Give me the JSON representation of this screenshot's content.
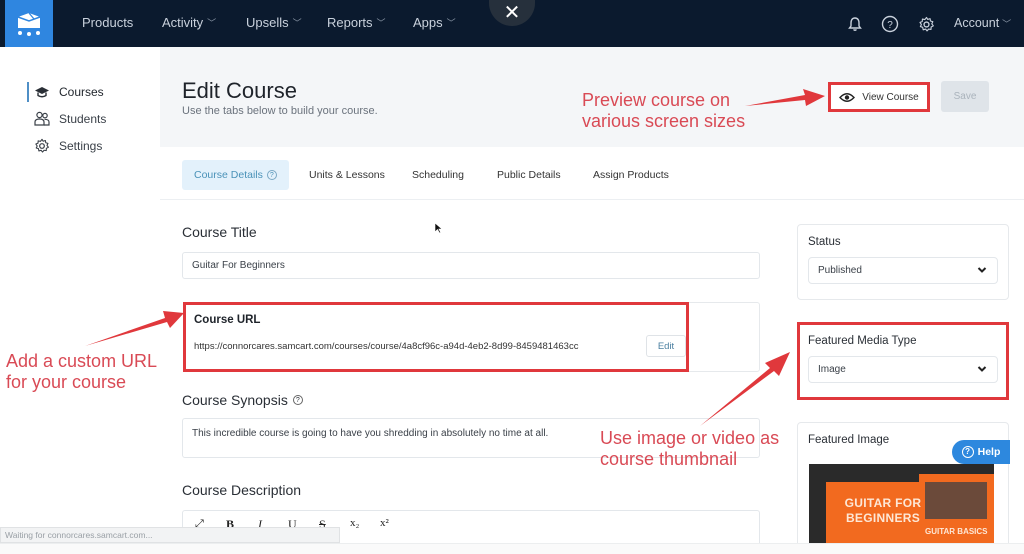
{
  "topnav": {
    "logo_icon": "shopping-cart-box-icon",
    "items": [
      {
        "label": "Products",
        "has_dropdown": false
      },
      {
        "label": "Activity",
        "has_dropdown": true
      },
      {
        "label": "Upsells",
        "has_dropdown": true
      },
      {
        "label": "Reports",
        "has_dropdown": true
      },
      {
        "label": "Apps",
        "has_dropdown": true
      }
    ],
    "close_symbol": "✕",
    "icons": [
      "bell-icon",
      "help-circle-icon",
      "gear-icon"
    ],
    "account_label": "Account",
    "chevron": "⌄"
  },
  "sidebar": {
    "items": [
      {
        "label": "Courses",
        "icon": "graduation-cap-icon",
        "active": true
      },
      {
        "label": "Students",
        "icon": "users-icon",
        "active": false
      },
      {
        "label": "Settings",
        "icon": "gear-icon",
        "active": false
      }
    ]
  },
  "header": {
    "title": "Edit Course",
    "subtitle": "Use the tabs below to build your course.",
    "view_course_label": "View Course",
    "save_label": "Save"
  },
  "tabs": [
    {
      "label": "Course Details",
      "active": true,
      "help": "?"
    },
    {
      "label": "Units & Lessons",
      "active": false
    },
    {
      "label": "Scheduling",
      "active": false
    },
    {
      "label": "Public Details",
      "active": false
    },
    {
      "label": "Assign Products",
      "active": false
    }
  ],
  "form": {
    "course_title_label": "Course Title",
    "course_title_value": "Guitar For Beginners",
    "course_url_label": "Course URL",
    "course_url_value": "https://connorcares.samcart.com/courses/course/4a8cf96c-a94d-4eb2-8d99-8459481463cc",
    "edit_label": "Edit",
    "synopsis_label": "Course Synopsis",
    "synopsis_help": "?",
    "synopsis_value": "This incredible course is going to have you shredding in absolutely no time at all.",
    "description_label": "Course Description",
    "editor_tools": [
      "⤢",
      "B",
      "I",
      "U",
      "S",
      "x₂",
      "x²"
    ]
  },
  "right_panel": {
    "status_label": "Status",
    "status_value": "Published",
    "media_type_label": "Featured Media Type",
    "media_type_value": "Image",
    "featured_image_label": "Featured Image",
    "thumbnail_title": "GUITAR FOR BEGINNERS",
    "thumbnail_subtitle": "GUITAR BASICS"
  },
  "help_button": {
    "label": "Help",
    "icon": "?"
  },
  "annotations": {
    "preview": "Preview course on various screen sizes",
    "url": "Add a custom URL for your course",
    "thumbnail": "Use image or video as course thumbnail"
  },
  "browser_status": "Waiting for connorcares.samcart.com...",
  "colors": {
    "nav_bg": "#0b1a2e",
    "logo_bg": "#2f86e0",
    "annotation_red": "#e0383c",
    "active_tab_bg": "#e3f1fb",
    "help_blue": "#2d88de"
  }
}
